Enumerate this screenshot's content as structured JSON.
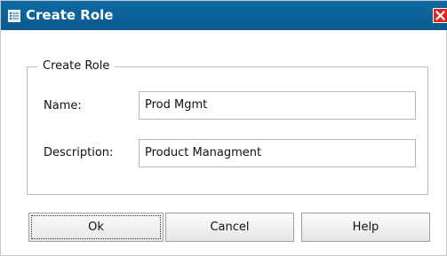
{
  "window": {
    "title": "Create Role"
  },
  "form": {
    "group_title": "Create Role",
    "name_label": "Name:",
    "name_value": "Prod Mgmt",
    "description_label": "Description:",
    "description_value": "Product Managment"
  },
  "buttons": {
    "ok": "Ok",
    "cancel": "Cancel",
    "help": "Help"
  },
  "colors": {
    "titlebar": "#0a5f99",
    "close": "#e2241b"
  }
}
